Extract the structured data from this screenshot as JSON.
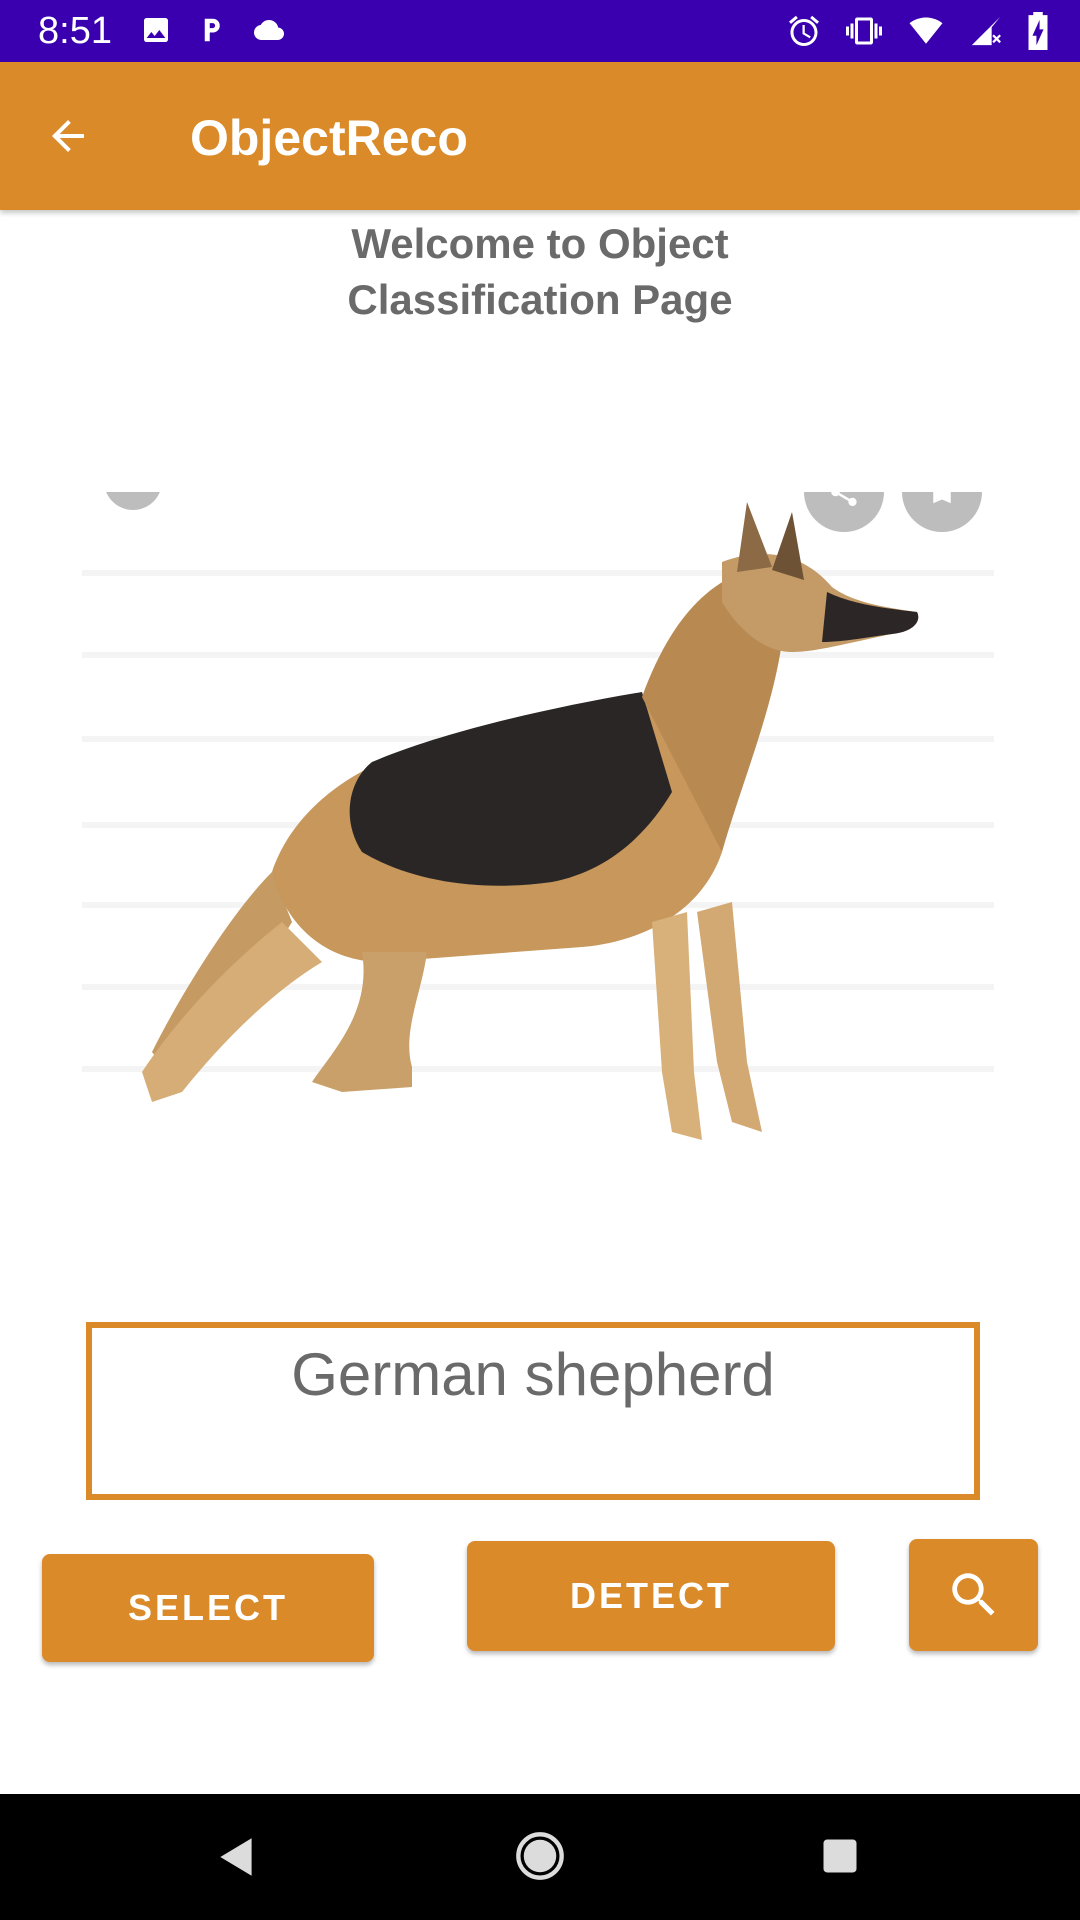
{
  "status_bar": {
    "time": "8:51",
    "left_icons": [
      "image-icon",
      "parking-p-icon",
      "cloud-icon"
    ],
    "right_icons": [
      "alarm-icon",
      "vibrate-icon",
      "wifi-icon",
      "signal-icon",
      "battery-charging-icon"
    ]
  },
  "app_bar": {
    "title": "ObjectReco",
    "back_icon": "arrow-back-icon",
    "color": "#da8a28"
  },
  "main": {
    "welcome_line1": "Welcome to Object",
    "welcome_line2": "Classification Page",
    "image_subject": "german-shepherd-dog-illustration",
    "image_controls": [
      "close-icon",
      "share-icon",
      "bookmark-icon"
    ],
    "result_text": "German shepherd",
    "buttons": {
      "select": "SELECT",
      "detect": "DETECT",
      "search_icon": "search-icon"
    }
  },
  "nav_bar": {
    "icons": [
      "nav-back-icon",
      "nav-home-icon",
      "nav-recent-icon"
    ]
  },
  "colors": {
    "status_bar": "#3a00b0",
    "accent": "#da8a28",
    "text_gray": "#6a6a6a"
  }
}
